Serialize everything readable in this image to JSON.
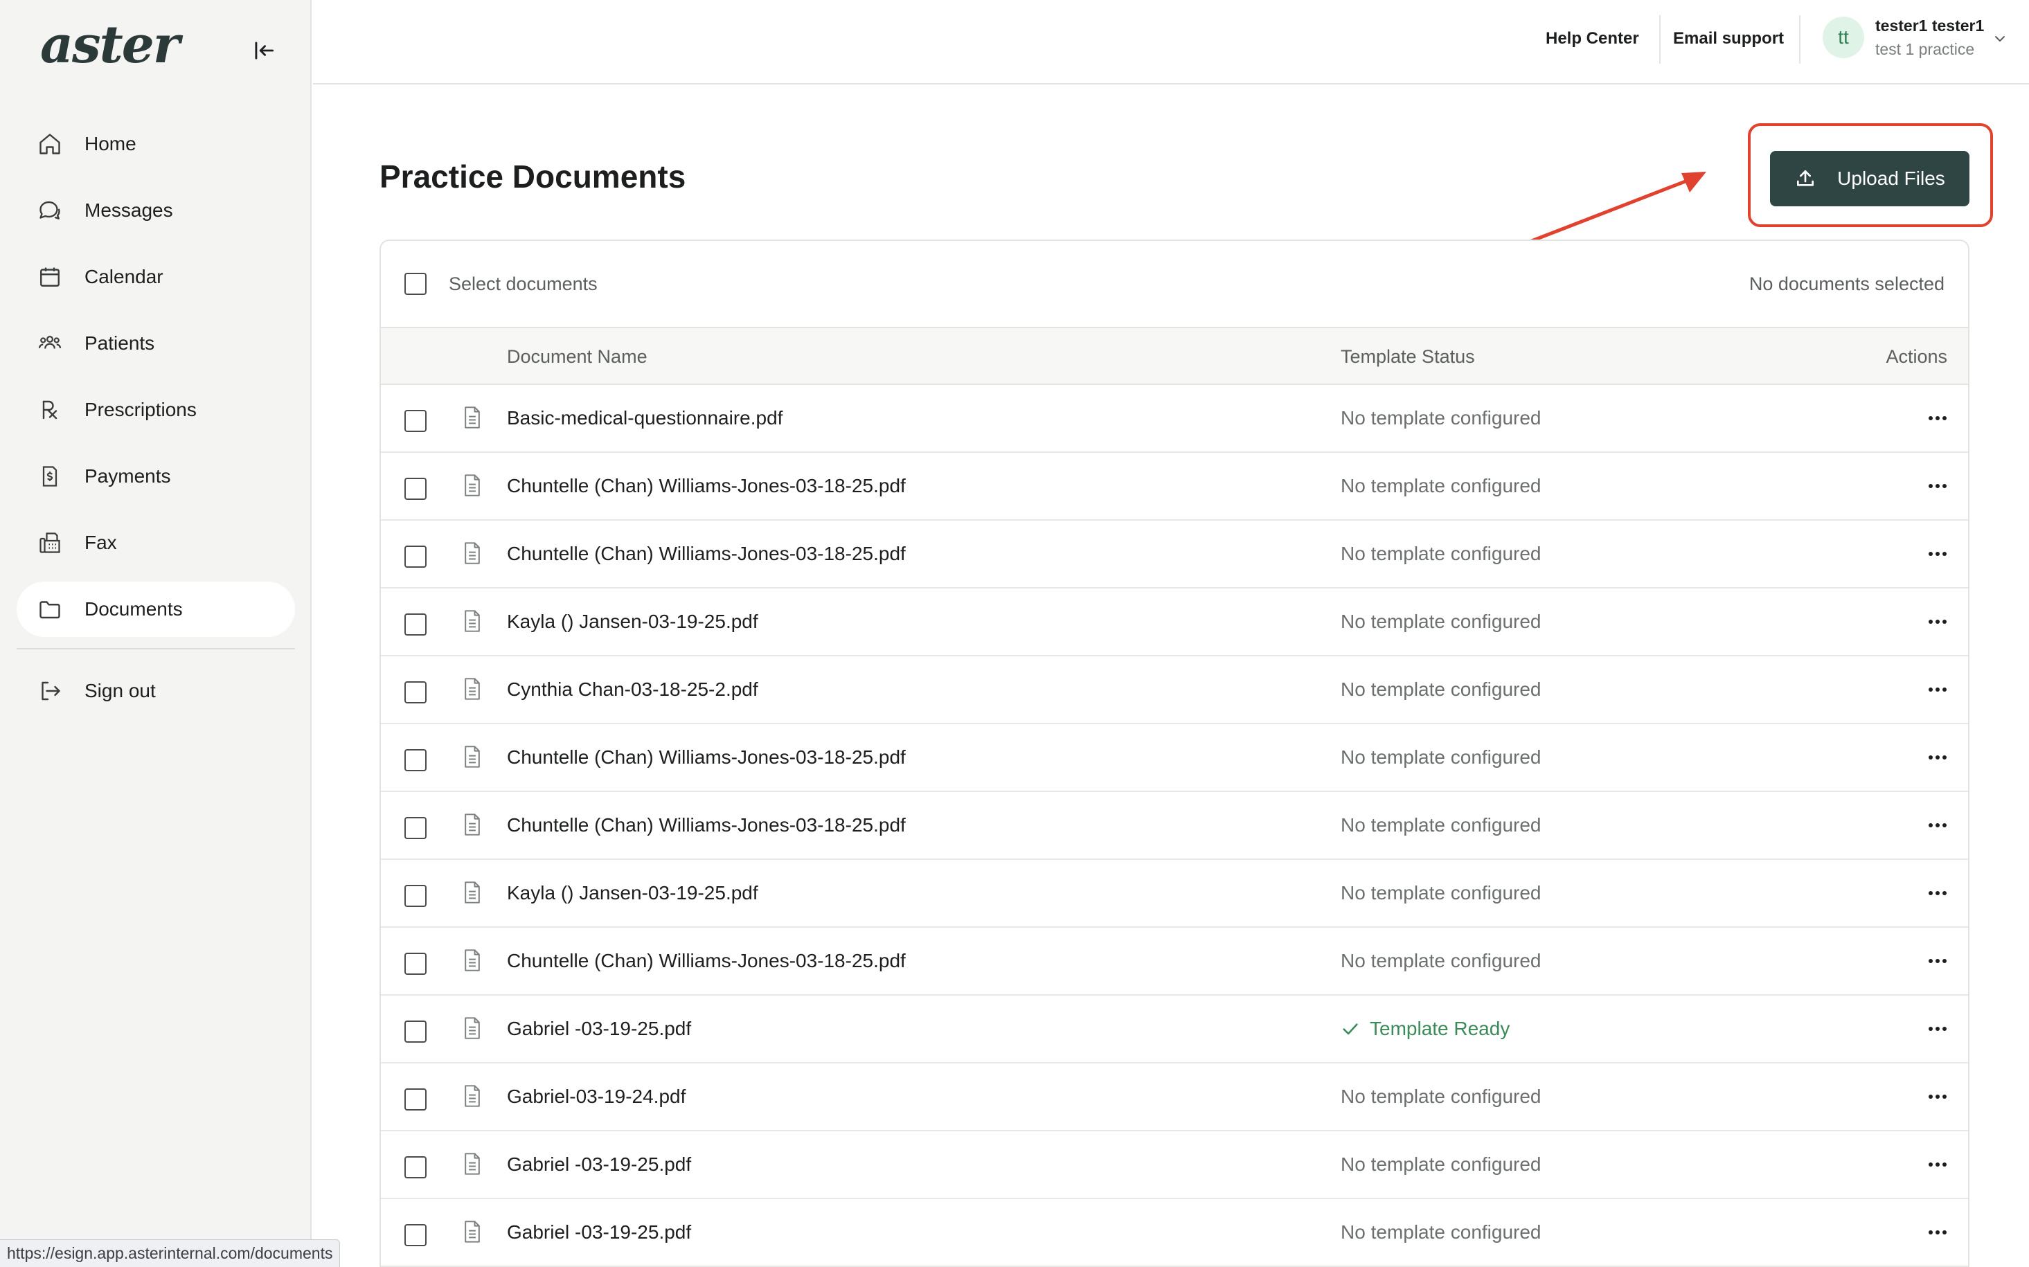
{
  "brand": {
    "logo_text": "aster"
  },
  "sidebar": {
    "items": [
      {
        "label": "Home",
        "icon": "home-icon"
      },
      {
        "label": "Messages",
        "icon": "messages-icon"
      },
      {
        "label": "Calendar",
        "icon": "calendar-icon"
      },
      {
        "label": "Patients",
        "icon": "patients-icon"
      },
      {
        "label": "Prescriptions",
        "icon": "prescription-icon"
      },
      {
        "label": "Payments",
        "icon": "payments-icon"
      },
      {
        "label": "Fax",
        "icon": "fax-icon"
      },
      {
        "label": "Documents",
        "icon": "folder-icon",
        "active": true
      }
    ],
    "sign_out": "Sign out"
  },
  "topbar": {
    "help_center": "Help Center",
    "email_support": "Email support",
    "user": {
      "initials": "tt",
      "name": "tester1 tester1",
      "practice": "test 1 practice"
    }
  },
  "page": {
    "title": "Practice Documents",
    "upload_button": "Upload Files",
    "select_documents": "Select documents",
    "selection_status": "No documents selected"
  },
  "table": {
    "columns": {
      "name": "Document Name",
      "status": "Template Status",
      "actions": "Actions"
    },
    "rows": [
      {
        "name": "Basic-medical-questionnaire.pdf",
        "status": "No template configured",
        "ready": false
      },
      {
        "name": "Chuntelle (Chan) Williams-Jones-03-18-25.pdf",
        "status": "No template configured",
        "ready": false
      },
      {
        "name": "Chuntelle (Chan) Williams-Jones-03-18-25.pdf",
        "status": "No template configured",
        "ready": false
      },
      {
        "name": "Kayla () Jansen-03-19-25.pdf",
        "status": "No template configured",
        "ready": false
      },
      {
        "name": "Cynthia Chan-03-18-25-2.pdf",
        "status": "No template configured",
        "ready": false
      },
      {
        "name": "Chuntelle (Chan) Williams-Jones-03-18-25.pdf",
        "status": "No template configured",
        "ready": false
      },
      {
        "name": "Chuntelle (Chan) Williams-Jones-03-18-25.pdf",
        "status": "No template configured",
        "ready": false
      },
      {
        "name": "Kayla () Jansen-03-19-25.pdf",
        "status": "No template configured",
        "ready": false
      },
      {
        "name": "Chuntelle (Chan) Williams-Jones-03-18-25.pdf",
        "status": "No template configured",
        "ready": false
      },
      {
        "name": "Gabriel -03-19-25.pdf",
        "status": "Template Ready",
        "ready": true
      },
      {
        "name": "Gabriel-03-19-24.pdf",
        "status": "No template configured",
        "ready": false
      },
      {
        "name": "Gabriel -03-19-25.pdf",
        "status": "No template configured",
        "ready": false
      },
      {
        "name": "Gabriel -03-19-25.pdf",
        "status": "No template configured",
        "ready": false
      }
    ]
  },
  "status_bar": {
    "url": "https://esign.app.asterinternal.com/documents"
  },
  "colors": {
    "accent": "#2f4544",
    "highlight": "#e0422f",
    "ready": "#3c8a5a"
  }
}
